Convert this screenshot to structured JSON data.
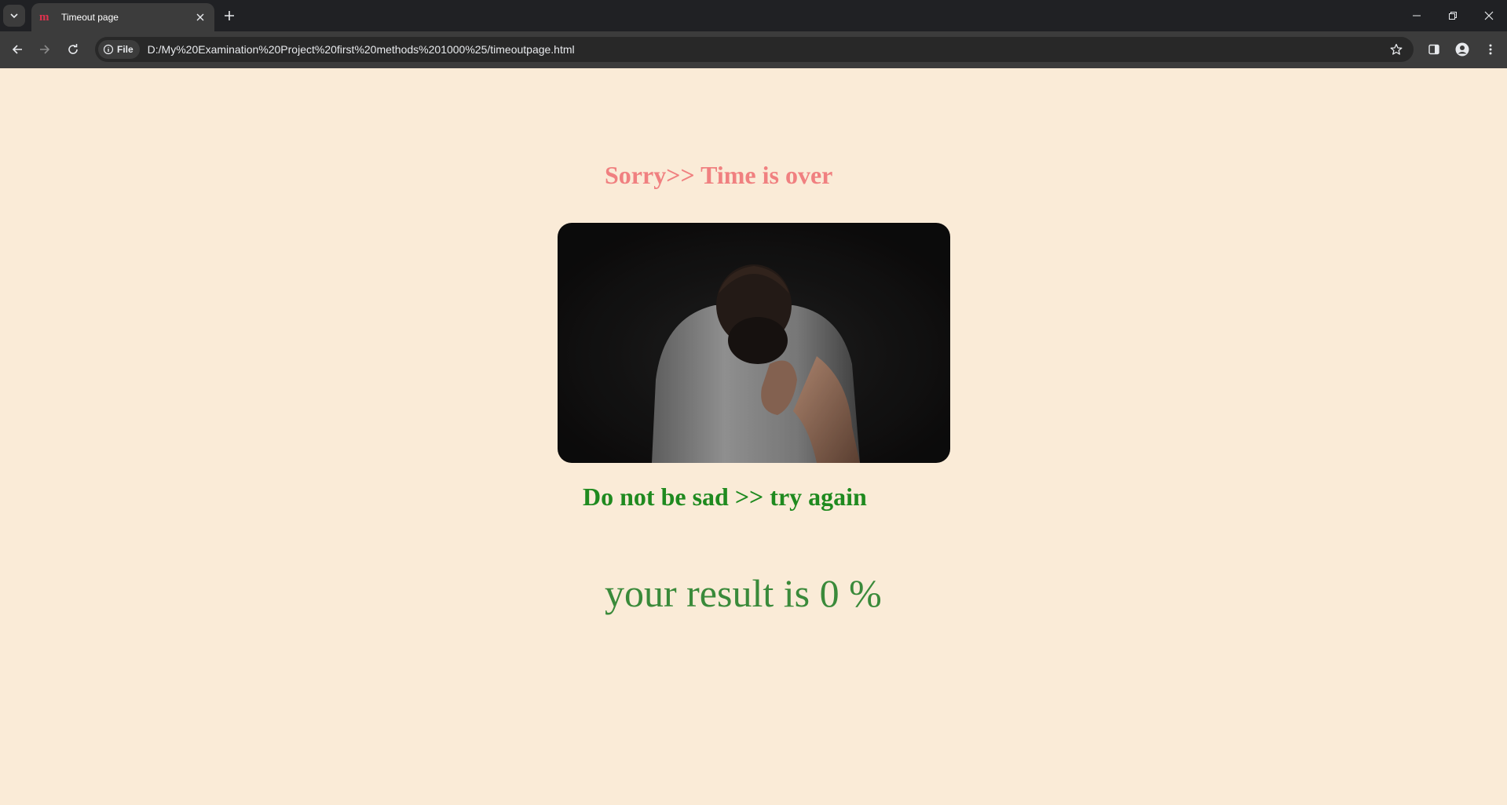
{
  "browser": {
    "tab_title": "Timeout page",
    "favicon_text": "m",
    "address_chip": "File",
    "url": "D:/My%20Examination%20Project%20first%20methods%201000%25/timeoutpage.html"
  },
  "page": {
    "sorry_heading": "Sorry>> Time is over",
    "image": {
      "description_icon": "sad-man-photo"
    },
    "sad_heading": "Do not be sad >> try again",
    "result_text": "your result is 0 %"
  },
  "colors": {
    "page_background": "#faebd7",
    "sorry_heading": "#f08080",
    "sad_heading": "#1f8a1f",
    "result_text": "#3a8a3a"
  }
}
